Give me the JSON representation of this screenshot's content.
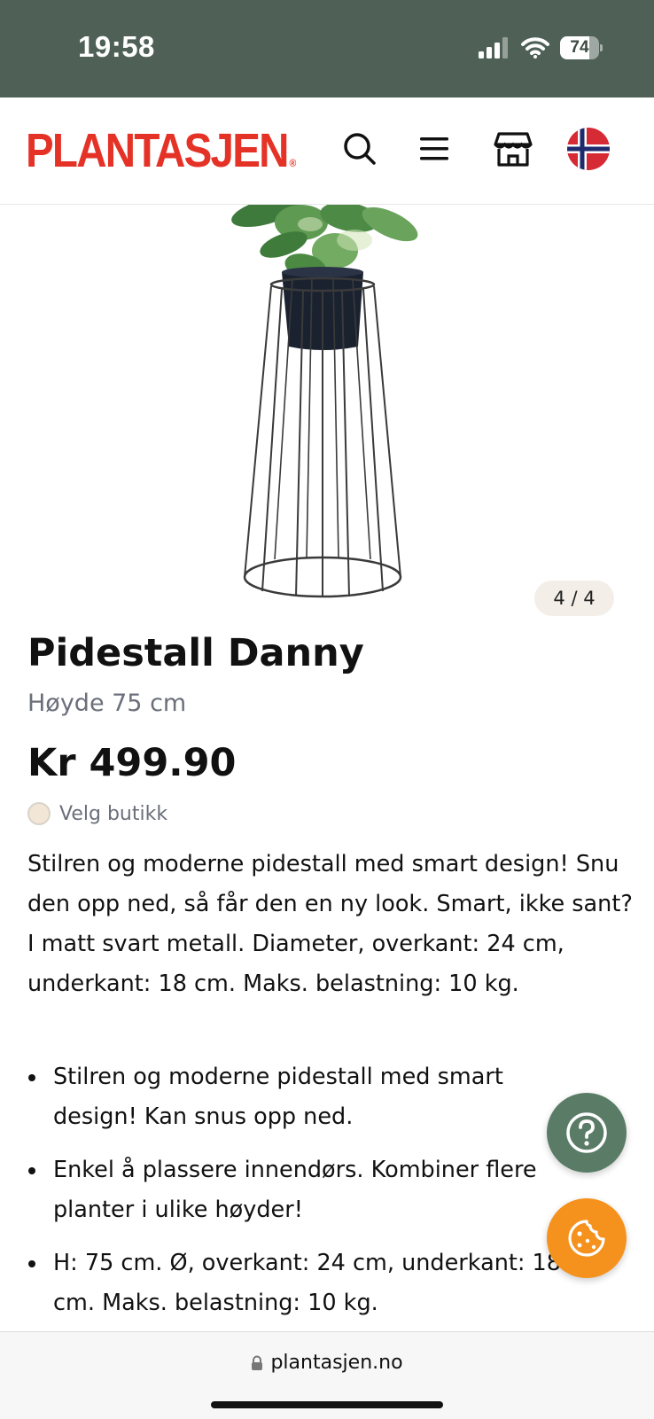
{
  "status_bar": {
    "time": "19:58",
    "battery": "74",
    "battery_level": 0.74
  },
  "header": {
    "logo": "PLANTASJEN",
    "logo_mark": "®"
  },
  "icons": {
    "search": "search-icon",
    "menu": "menu-icon",
    "store": "store-icon",
    "flag": "norway-flag-icon",
    "help": "question-icon",
    "cookie": "cookie-icon",
    "lock": "lock-icon"
  },
  "gallery": {
    "counter": "4 / 4"
  },
  "product": {
    "title": "Pidestall Danny",
    "subtitle": "Høyde 75 cm",
    "price": "Kr 499.90",
    "store_label": "Velg butikk",
    "description": "Stilren og moderne pidestall med smart design! Snu den opp ned, så får den en ny look. Smart, ikke sant? I matt svart metall. Diameter, overkant: 24 cm, underkant: 18 cm. Maks. belastning: 10 kg.",
    "bullets": [
      {
        "line1": "Stilren og moderne pidestall med smart",
        "line2": "design! Kan snus opp ned."
      },
      {
        "line1": "Enkel å plassere innendørs. Kombiner flere",
        "line2": "planter i ulike høyder!"
      },
      {
        "line1": "H: 75 cm. Ø, overkant: 24 cm, underkant: 18",
        "line2": "cm. Maks. belastning: 10 kg."
      }
    ]
  },
  "browser": {
    "url": "plantasjen.no"
  },
  "colors": {
    "status_bar_bg": "#4f6156",
    "brand_red": "#e53227",
    "help_button": "#5a7c67",
    "cookie_button": "#f5921e",
    "muted_text": "#6a6f7a"
  }
}
